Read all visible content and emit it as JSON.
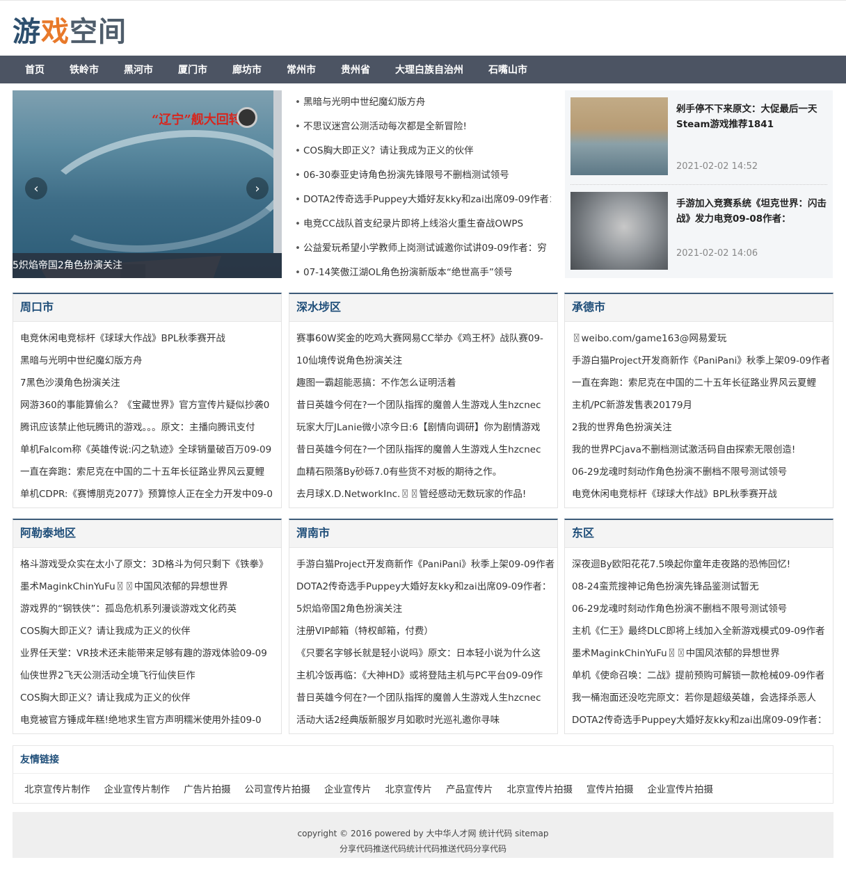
{
  "logo": {
    "part1": "游",
    "part2": "戏",
    "part3": "空间"
  },
  "nav": [
    "首页",
    "铁岭市",
    "黑河市",
    "厦门市",
    "廊坊市",
    "常州市",
    "贵州省",
    "大理白族自治州",
    "石嘴山市"
  ],
  "slider": {
    "banner": "“辽宁”舰大回转",
    "caption": "5炽焰帝国2角色扮演关注",
    "prev_icon": "chevron-left-icon",
    "next_icon": "chevron-right-icon"
  },
  "headlines": [
    "黑暗与光明中世纪魔幻版方舟",
    "不思议迷宫公测活动每次都是全新冒险!",
    "COS胸大即正义？请让我成为正义的伙伴",
    "06-30泰亚史诗角色扮演先锋限号不删档测试领号",
    "DOTA2传奇选手Puppey大婚好友kky和zai出席09-09作者：",
    "电竞CC战队首支纪录片即将上线浴火重生奋战OWPS",
    "公益爱玩希望小学教师上岗测试诚邀你试讲09-09作者：穷",
    "07-14笑傲江湖OL角色扮演新版本“绝世高手”领号"
  ],
  "featured": [
    {
      "title": "剁手停不下来原文：大促最后一天Steam游戏推荐1841",
      "time": "2021-02-02 14:52"
    },
    {
      "title": "手游加入竞赛系统《坦克世界：闪击战》发力电竞09-08作者：",
      "time": "2021-02-02 14:06"
    }
  ],
  "categories": [
    {
      "title": "周口市",
      "items": [
        "电竞休闲电竞标杆《球球大作战》BPL秋季赛开战",
        "黑暗与光明中世纪魔幻版方舟",
        "7黑色沙漠角色扮演关注",
        "网游360的事能算偷么？《宝藏世界》官方宣传片疑似抄袭0",
        "腾讯应该禁止他玩腾讯的游戏。。。原文：主播向腾讯支付",
        "单机Falcom称《英雄传说:闪之轨迹》全球销量破百万09-09",
        "一直在奔跑：索尼克在中国的二十五年长征路业界风云夏鲤",
        "单机CDPR:《赛博朋克2077》预算惊人正在全力开发中09-0"
      ]
    },
    {
      "title": "深水埗区",
      "items": [
        "赛事60W奖金的吃鸡大赛网易CC举办《鸡王杯》战队赛09-",
        "10仙境传说角色扮演关注",
        "趣图一霸超能恶搞：不作怎么证明活着",
        "昔日英雄今何在?一个团队指挥的魔兽人生游戏人生hzcnec",
        "玩家大厅JLanie微小凉今日:6【剧情向调研】你为剧情游戏",
        "昔日英雄今何在?一个团队指挥的魔兽人生游戏人生hzcnec",
        "血精石陨落By砂砾7.0有些货不对板的期待之作。",
        "去月球X.D.NetworkInc.〿〿管经感动无数玩家的作品!"
      ]
    },
    {
      "title": "承德市",
      "items": [
        "〿weibo.com/game163@网易爱玩",
        "手游白猫Project开发商新作《PaniPani》秋季上架09-09作者",
        "一直在奔跑：索尼克在中国的二十五年长征路业界风云夏鲤",
        "主机/PC新游发售表20179月",
        "2我的世界角色扮演关注",
        "我的世界PCjava不删档测试激活码自由探索无限创造!",
        "06-29龙魂时刻动作角色扮演不删档不限号测试领号",
        "电竞休闲电竞标杆《球球大作战》BPL秋季赛开战"
      ]
    },
    {
      "title": "阿勒泰地区",
      "items": [
        "格斗游戏受众实在太小了原文：3D格斗为何只剩下《铁拳》",
        "墨术MaginkChinYuFu〿〿中国风浓郁的异想世界",
        "游戏界的“钢铁侠”：孤岛危机系列漫谈游戏文化药英",
        "COS胸大即正义？请让我成为正义的伙伴",
        "业界任天堂：VR技术还未能带来足够有趣的游戏体验09-09",
        "仙侠世界2飞天公测活动全境飞行仙侠巨作",
        "COS胸大即正义？请让我成为正义的伙伴",
        "电竞被官方锤成年糕!绝地求生官方声明糯米使用外挂09-0"
      ]
    },
    {
      "title": "渭南市",
      "items": [
        "手游白猫Project开发商新作《PaniPani》秋季上架09-09作者",
        "DOTA2传奇选手Puppey大婚好友kky和zai出席09-09作者：",
        "5炽焰帝国2角色扮演关注",
        "注册VIP邮箱（特权邮箱，付费）",
        "《只要名字够长就是轻小说吗》原文：日本轻小说为什么这",
        "主机冷饭再临：《大神HD》或将登陆主机与PC平台09-09作",
        "昔日英雄今何在?一个团队指挥的魔兽人生游戏人生hzcnec",
        "活动大话2经典版新服岁月如歌时光巡礼邀你寻味"
      ]
    },
    {
      "title": "东区",
      "items": [
        "深夜迴By欧阳花花7.5唤起你童年走夜路的恐怖回忆!",
        "08-24蛮荒搜神记角色扮演先锋品鉴测试暂无",
        "06-29龙魂时刻动作角色扮演不删档不限号测试领号",
        "主机《仁王》最终DLC即将上线加入全新游戏模式09-09作者",
        "墨术MaginkChinYuFu〿〿中国风浓郁的异想世界",
        "单机《使命召唤：二战》提前预购可解锁一款枪械09-09作者",
        "我一桶泡面还没吃完原文：若你是超级英雄，会选择杀恶人",
        "DOTA2传奇选手Puppey大婚好友kky和zai出席09-09作者："
      ]
    }
  ],
  "friends": {
    "title": "友情链接",
    "links": [
      "北京宣传片制作",
      "企业宣传片制作",
      "广告片拍摄",
      "公司宣传片拍摄",
      "企业宣传片",
      "北京宣传片",
      "产品宣传片",
      "北京宣传片拍摄",
      "宣传片拍摄",
      "企业宣传片拍摄"
    ]
  },
  "footer": {
    "line1": "copyright © 2016 powered by 大中华人才网  统计代码 sitemap",
    "line2": "分享代码推送代码统计代码推送代码分享代码"
  }
}
